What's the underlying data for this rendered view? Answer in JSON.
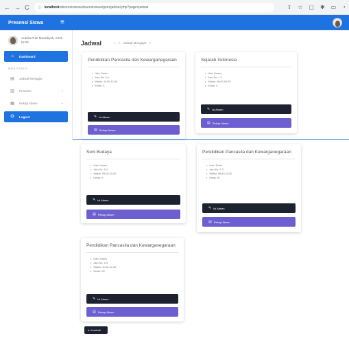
{
  "browser": {
    "back": "←",
    "forward": "→",
    "reload": "C",
    "info": "ⓘ",
    "url_host": "localhost",
    "url_path": "/absensisiswa/absensisiswa/guru/jadwal.php?page=jadwal"
  },
  "app": {
    "brand": "Presensi Siswa",
    "menu_icon": "hamburger-icon"
  },
  "sidebar": {
    "user_name": "Ardelia Putri Maulidiyah, S.Pd. M.Pd",
    "section_label": "MAIN STUDIO",
    "items": [
      {
        "label": "Dashboard",
        "icon": "home-icon",
        "active": true
      },
      {
        "label": "Jadwal Mengajar",
        "icon": "calendar-icon",
        "active": false
      },
      {
        "label": "Presensi",
        "icon": "clipboard-icon",
        "active": false
      },
      {
        "label": "Rekap Absen",
        "icon": "table-icon",
        "active": false
      }
    ],
    "logout": "Logout"
  },
  "main": {
    "title": "Jadwal",
    "breadcrumb": [
      "⌂",
      "Jadwal Mengajar"
    ],
    "back_label": "Kembali"
  },
  "labels": {
    "isi_absen": "Isi Absen",
    "rekap_absen": "Rekap Absen"
  },
  "cards": [
    {
      "title": "Pendidikan Pancasila dan Kewarganegaraan",
      "details": [
        "Hari: Senin",
        "Jam Ke: 3-4",
        "Waktu: 11:00-12:40",
        "Kelas: X"
      ]
    },
    {
      "title": "Sejarah Indonesia",
      "details": [
        "Hari: Kamis",
        "Jam Ke: 1-2",
        "Waktu: 08:00-09:20",
        "Kelas: X"
      ]
    },
    {
      "title": "Seni Budaya",
      "details": [
        "Hari: Kamis",
        "Jam Ke: 3-4",
        "Waktu: 09:20-10:40",
        "Kelas: X"
      ]
    },
    {
      "title": "Pendidikan Pancasila dan Kewarganegaraan",
      "details": [
        "Hari: Senin",
        "Jam Ke: 2-3",
        "Waktu: 08:40-10:00",
        "Kelas: XI"
      ]
    },
    {
      "title": "Pendidikan Pancasila dan Kewarganegaraan",
      "details": [
        "Hari: Kamis",
        "Jam Ke: 3-4",
        "Waktu: 11:20-12:40",
        "Kelas: XII"
      ]
    }
  ]
}
